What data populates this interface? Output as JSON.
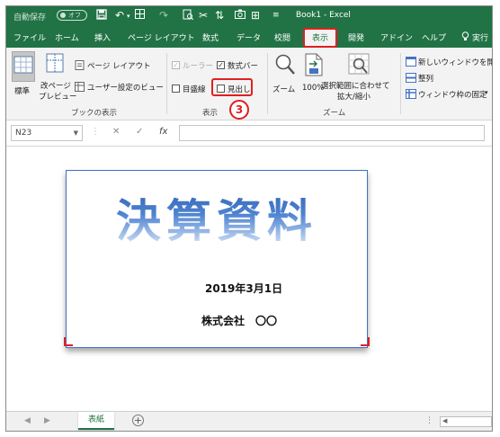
{
  "titlebar": {
    "autosave_label": "自動保存",
    "autosave_state": "オフ",
    "doc_title": "Book1  -  Excel",
    "qat_icons": [
      "save-icon",
      "undo-icon",
      "dropdown-arrow-icon",
      "borders-icon",
      "redo-icon",
      "print-preview-icon",
      "format-painter-icon",
      "sort-icon",
      "camera-icon",
      "more-commands-icon",
      "customize-qat-icon"
    ]
  },
  "tabs": [
    "ファイル",
    "ホーム",
    "挿入",
    "ページ レイアウト",
    "数式",
    "データ",
    "校閲",
    "表示",
    "開発",
    "アドイン",
    "ヘルプ",
    "実行"
  ],
  "active_tab": "表示",
  "ribbon": {
    "workbook_views": {
      "normal": "標準",
      "page_break_line1": "改ページ",
      "page_break_line2": "プレビュー",
      "page_layout": "ページ レイアウト",
      "custom_views": "ユーザー設定のビュー",
      "group_label": "ブックの表示"
    },
    "show": {
      "ruler": "ルーラー",
      "formula_bar": "数式バー",
      "gridlines": "目盛線",
      "headings": "見出し",
      "group_label": "表示",
      "ruler_checked": true,
      "formula_bar_checked": true,
      "gridlines_checked": false,
      "headings_checked": false
    },
    "zoom": {
      "zoom": "ズーム",
      "hundred": "100%",
      "fit_line1": "選択範囲に合わせて",
      "fit_line2": "拡大/縮小",
      "group_label": "ズーム"
    },
    "window": {
      "new_window": "新しいウィンドウを開く",
      "arrange": "整列",
      "freeze": "ウィンドウ枠の固定"
    }
  },
  "step_number": "3",
  "formula_bar": {
    "name_box": "N23",
    "cancel": "✕",
    "enter": "✓",
    "fx": "fx",
    "value": ""
  },
  "sheet_content": {
    "title": "決算資料",
    "date": "2019年3月1日",
    "company": "株式会社　〇〇"
  },
  "sheet_tabs": {
    "active": "表紙",
    "add": "+"
  },
  "colors": {
    "excel_green": "#217346",
    "highlight_red": "#e02020",
    "textbox_border": "#4472c4"
  }
}
